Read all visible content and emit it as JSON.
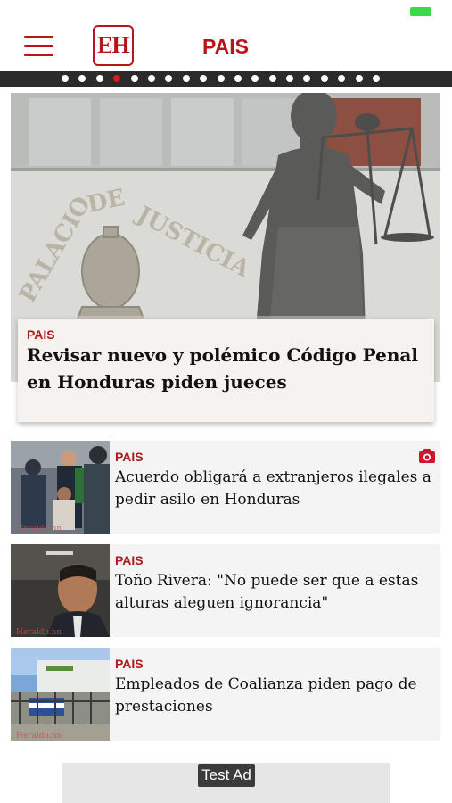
{
  "header": {
    "logo_text": "EH",
    "section_title": "PAIS"
  },
  "carousel": {
    "dot_count": 19,
    "active_index": 3
  },
  "hero": {
    "section": "PAIS",
    "headline": "Revisar nuevo y polémico Código Penal en Honduras piden jueces",
    "image_text": "PALACIO DE JUSTICIA"
  },
  "articles": [
    {
      "section": "PAIS",
      "headline": "Acuerdo obligará a extranjeros ilegales a pedir asilo en Honduras",
      "icon": "camera-icon",
      "watermark": "Heraldo.hn"
    },
    {
      "section": "PAIS",
      "headline": "Toño Rivera: \"No puede ser que a estas alturas aleguen ignorancia\"",
      "watermark": "Heraldo.hn"
    },
    {
      "section": "PAIS",
      "headline": "Empleados de Coalianza piden pago de prestaciones",
      "watermark": "Heraldo.hn"
    }
  ],
  "ad": {
    "label": "Test Ad"
  },
  "colors": {
    "brand_red": "#b8141b",
    "active_dot": "#d21f24",
    "battery": "#3ad94b"
  }
}
